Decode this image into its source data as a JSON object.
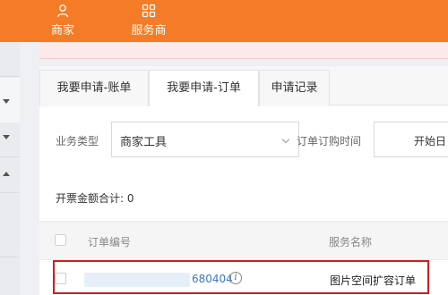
{
  "topnav": {
    "items": [
      {
        "label": "商家",
        "icon": "user-icon"
      },
      {
        "label": "服务商",
        "icon": "grid-icon"
      }
    ]
  },
  "tabs": [
    {
      "label": "我要申请-账单",
      "active": false
    },
    {
      "label": "我要申请-订单",
      "active": true
    },
    {
      "label": "申请记录",
      "active": false
    }
  ],
  "filters": {
    "business_type_label": "业务类型",
    "business_type_value": "商家工具",
    "order_time_label": "订单订购时间",
    "start_date_placeholder": "开始日"
  },
  "summary": "开票金额合计: 0",
  "table": {
    "columns": [
      "订单编号",
      "服务名称"
    ],
    "rows": [
      {
        "order_id": "680404",
        "service_name": "图片空间扩容订单"
      }
    ]
  },
  "colors": {
    "brand_orange": "#f57c26",
    "link_blue": "#3a78c3",
    "highlight_red": "#cc1f1f"
  }
}
